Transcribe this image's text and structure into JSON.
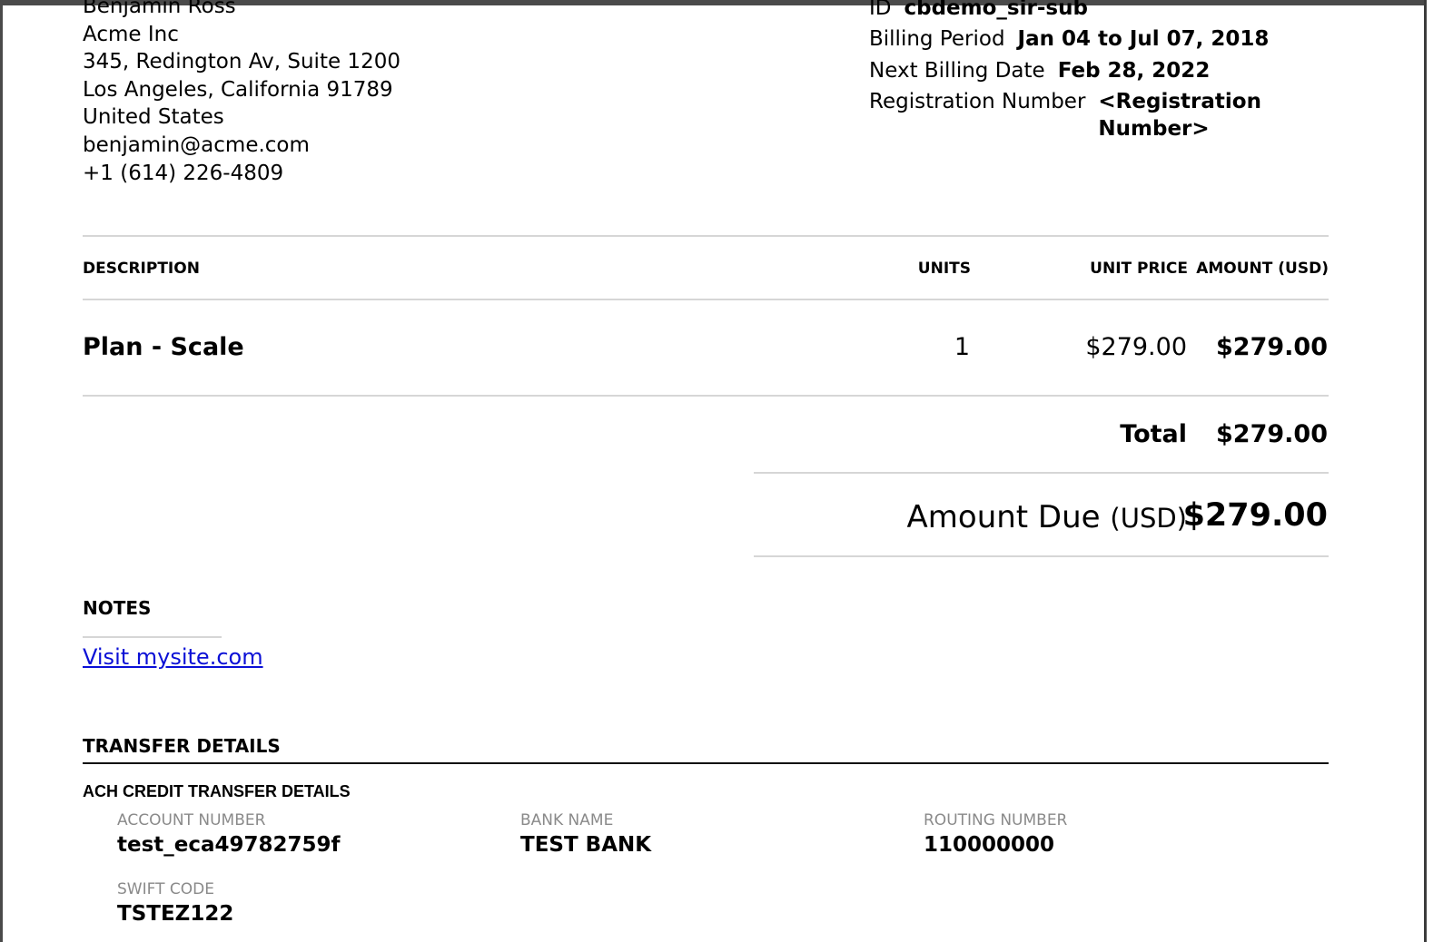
{
  "customer": {
    "name": "Benjamin Ross",
    "company": "Acme Inc",
    "street": "345, Redington Av, Suite 1200",
    "city_line": "Los Angeles, California 91789",
    "country": "United States",
    "email": "benjamin@acme.com",
    "phone": "+1 (614) 226-4809"
  },
  "invoice_meta": {
    "id_label": "ID",
    "id_value": "cbdemo_sir-sub",
    "billing_period_label": "Billing Period",
    "billing_period_value": "Jan 04 to Jul 07, 2018",
    "next_billing_label": "Next Billing Date",
    "next_billing_value": "Feb 28, 2022",
    "registration_label": "Registration Number",
    "registration_value": "<Registration Number>"
  },
  "line_items_table": {
    "headers": {
      "description": "DESCRIPTION",
      "units": "UNITS",
      "unit_price": "UNIT PRICE",
      "amount": "AMOUNT (USD)"
    },
    "rows": [
      {
        "description": "Plan - Scale",
        "units": "1",
        "unit_price": "$279.00",
        "amount": "$279.00"
      }
    ]
  },
  "totals": {
    "total_label": "Total",
    "total_value": "$279.00",
    "amount_due_label": "Amount Due",
    "amount_due_unit": "(USD)",
    "amount_due_value": "$279.00"
  },
  "notes": {
    "title": "NOTES",
    "link_text": "Visit mysite.com"
  },
  "transfer": {
    "title": "TRANSFER DETAILS",
    "subtitle": "ACH CREDIT TRANSFER DETAILS",
    "account_number_label": "ACCOUNT NUMBER",
    "account_number_value": "test_eca49782759f",
    "bank_name_label": "BANK NAME",
    "bank_name_value": "TEST BANK",
    "routing_number_label": "ROUTING NUMBER",
    "routing_number_value": "110000000",
    "swift_code_label": "SWIFT CODE",
    "swift_code_value": "TSTEZ122"
  }
}
